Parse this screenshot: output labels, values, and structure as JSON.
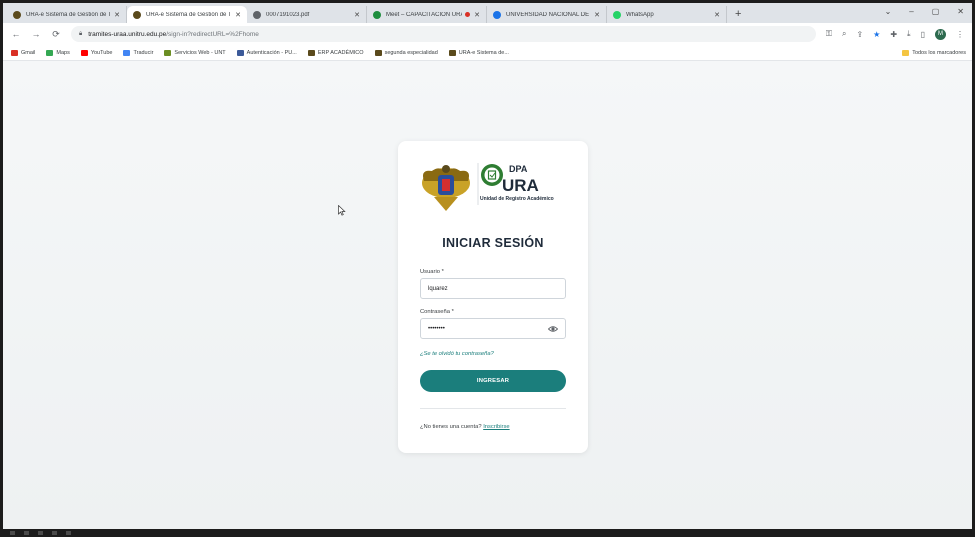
{
  "browser": {
    "tabs": [
      {
        "title": "URA-e Sistema de Gestión de Tr",
        "active": false,
        "favicon_color": "#5a4a1c"
      },
      {
        "title": "URA-e Sistema de Gestión de Tr",
        "active": true,
        "favicon_color": "#5a4a1c"
      },
      {
        "title": "0007191023.pdf",
        "active": false,
        "favicon_color": "#5f6368"
      },
      {
        "title": "Meet – CAPACITACIÓN URA",
        "active": false,
        "favicon_color": "#1e8e3e",
        "recording": true
      },
      {
        "title": "UNIVERSIDAD NACIONAL DE TR",
        "active": false,
        "favicon_color": "#1a73e8"
      },
      {
        "title": "WhatsApp",
        "active": false,
        "favicon_color": "#25d366"
      }
    ],
    "new_tab_icon": "+",
    "window_controls": [
      "⌄",
      "–",
      "▢",
      "✕"
    ],
    "address": {
      "host": "tramites-uraa.unitru.edu.pe",
      "path": "/sign-in?redirectURL=%2Fhome"
    },
    "profile_initial": "M",
    "bookmarks": [
      {
        "label": "Gmail",
        "color": "#d93025"
      },
      {
        "label": "Maps",
        "color": "#34a853"
      },
      {
        "label": "YouTube",
        "color": "#ff0000"
      },
      {
        "label": "Traducir",
        "color": "#4285f4"
      },
      {
        "label": "Servicios Web - UNT",
        "color": "#6b8e23"
      },
      {
        "label": "Autenticación - PU...",
        "color": "#3c5a99"
      },
      {
        "label": "ERP ACADÉMICO",
        "color": "#5a4a1c"
      },
      {
        "label": "segunda especialidad",
        "color": "#5a4a1c"
      },
      {
        "label": "URA-e Sistema de...",
        "color": "#5a4a1c"
      }
    ],
    "bookmarks_right": "Todos los marcadores"
  },
  "login": {
    "logo": {
      "dpa": "DPA",
      "ura": "URA",
      "subtitle": "Unidad de Registro Académico"
    },
    "title": "INICIAR SESIÓN",
    "username_label": "Usuario *",
    "username_value": "lquarez",
    "password_label": "Contraseña *",
    "password_value": "••••••••",
    "forgot_link": "¿Se te olvidó tu contraseña?",
    "submit_label": "INGRESAR",
    "signup_prompt": "¿No tienes una cuenta?",
    "signup_link": "Inscribirse"
  },
  "colors": {
    "accent": "#1b7e7c",
    "title": "#1f2b3a"
  }
}
